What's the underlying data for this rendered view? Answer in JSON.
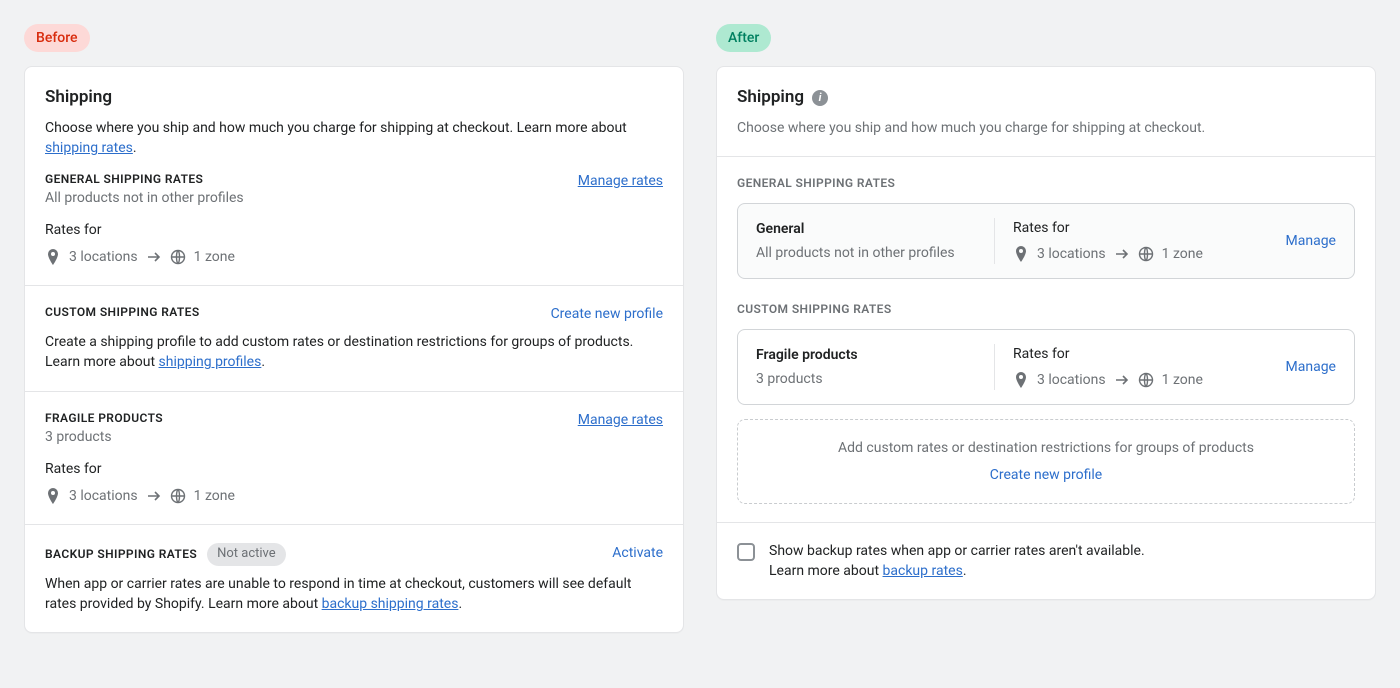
{
  "labels": {
    "before": "Before",
    "after": "After"
  },
  "before": {
    "title": "Shipping",
    "intro_a": "Choose where you ship and how much you charge for shipping at checkout. Learn more about ",
    "intro_link": "shipping rates",
    "intro_b": ".",
    "general": {
      "heading": "GENERAL SHIPPING RATES",
      "sub": "All products not in other profiles",
      "manage": "Manage rates",
      "rates_for": "Rates for",
      "locations": "3 locations",
      "zone": "1 zone"
    },
    "custom": {
      "heading": "CUSTOM SHIPPING RATES",
      "create": "Create new profile",
      "desc_a": "Create a shipping profile to add custom rates or destination restrictions for groups of products. Learn more about ",
      "desc_link": "shipping profiles",
      "desc_b": "."
    },
    "fragile": {
      "heading": "FRAGILE PRODUCTS",
      "sub": "3 products",
      "manage": "Manage rates",
      "rates_for": "Rates for",
      "locations": "3 locations",
      "zone": "1 zone"
    },
    "backup": {
      "heading": "BACKUP SHIPPING RATES",
      "status": "Not active",
      "activate": "Activate",
      "desc_a": "When app or carrier rates are unable to respond in time at checkout, customers will see default rates provided by Shopify. Learn more about ",
      "desc_link": "backup shipping rates",
      "desc_b": "."
    }
  },
  "after": {
    "title": "Shipping",
    "intro": "Choose where you ship and how much you charge for shipping at checkout.",
    "general_label": "GENERAL SHIPPING RATES",
    "custom_label": "CUSTOM SHIPPING RATES",
    "profiles": {
      "general": {
        "title": "General",
        "sub": "All products not in other profiles",
        "rates_for": "Rates for",
        "locations": "3 locations",
        "zone": "1 zone",
        "manage": "Manage"
      },
      "fragile": {
        "title": "Fragile products",
        "sub": "3 products",
        "rates_for": "Rates for",
        "locations": "3 locations",
        "zone": "1 zone",
        "manage": "Manage"
      }
    },
    "add_custom": {
      "text": "Add custom rates or destination restrictions for groups of products",
      "link": "Create new profile"
    },
    "backup": {
      "text_a": "Show backup rates when app or carrier rates aren't available.",
      "text_b": "Learn more about ",
      "link": "backup rates",
      "text_c": "."
    }
  }
}
